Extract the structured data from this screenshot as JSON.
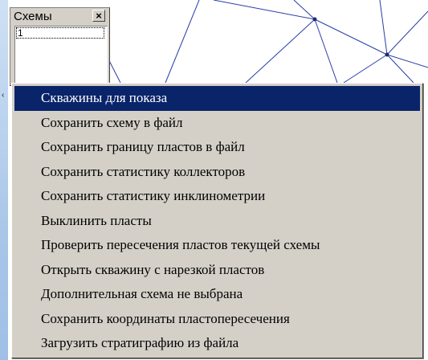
{
  "schemes_panel": {
    "title": "Схемы",
    "close_glyph": "×",
    "list_items": [
      "1"
    ]
  },
  "context_menu": {
    "items": [
      "Скважины для показа",
      "Сохранить схему в файл",
      "Сохранить границу пластов в файл",
      "Сохранить статистику коллекторов",
      "Сохранить статистику инклинометрии",
      "Выклинить пласты",
      "Проверить пересечения пластов текущей схемы",
      "Открыть скважину с нарезкой пластов",
      "Дополнительная схема не выбрана",
      "Сохранить координаты пластопересечения",
      "Загрузить стратиграфию из файла"
    ],
    "selected_index": 0
  },
  "colors": {
    "selection": "#0a246a",
    "triangulation_lines": "#2a3ea8",
    "menu_background": "#d4d0c8"
  }
}
